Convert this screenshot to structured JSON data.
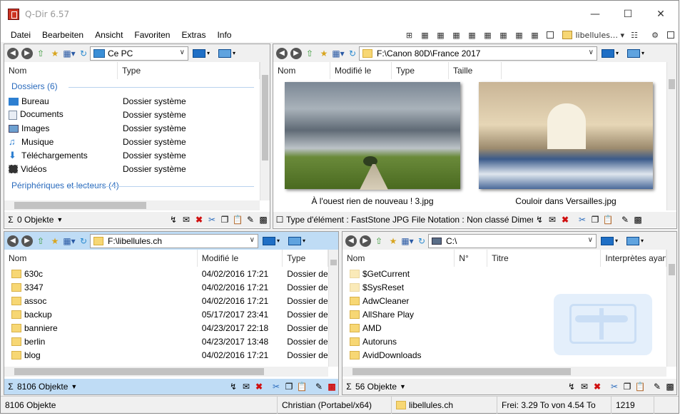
{
  "app": {
    "title": "Q-Dir 6.57"
  },
  "menu": {
    "items": [
      "Datei",
      "Bearbeiten",
      "Ansicht",
      "Favoriten",
      "Extras",
      "Info"
    ],
    "favorites_label": "libellules"
  },
  "panes": {
    "tl": {
      "address": "Ce PC",
      "headers": [
        "Nom",
        "Type"
      ],
      "groups": [
        {
          "label": "Dossiers (6)"
        },
        {
          "label": "Périphériques et lecteurs (4)"
        }
      ],
      "items": [
        {
          "name": "Bureau",
          "type": "Dossier système",
          "icon": "desktop-icon"
        },
        {
          "name": "Documents",
          "type": "Dossier système",
          "icon": "documents-icon"
        },
        {
          "name": "Images",
          "type": "Dossier système",
          "icon": "pictures-icon"
        },
        {
          "name": "Musique",
          "type": "Dossier système",
          "icon": "music-icon"
        },
        {
          "name": "Téléchargements",
          "type": "Dossier système",
          "icon": "downloads-icon"
        },
        {
          "name": "Vidéos",
          "type": "Dossier système",
          "icon": "videos-icon"
        }
      ],
      "status": "0 Objekte"
    },
    "tr": {
      "address": "F:\\Canon 80D\\France 2017",
      "headers": [
        "Nom",
        "Modifié le",
        "Type",
        "Taille"
      ],
      "images": [
        {
          "caption": "À l'ouest rien de nouveau ! 3.jpg"
        },
        {
          "caption": "Couloir dans Versailles.jpg"
        }
      ],
      "status": "Type d'élément : FastStone JPG File Notation : Non classé Dimen"
    },
    "bl": {
      "address": "F:\\libellules.ch",
      "headers": [
        "Nom",
        "Modifié le",
        "Type"
      ],
      "items": [
        {
          "name": "630c",
          "date": "04/02/2016 17:21",
          "type": "Dossier de"
        },
        {
          "name": "3347",
          "date": "04/02/2016 17:21",
          "type": "Dossier de"
        },
        {
          "name": "assoc",
          "date": "04/02/2016 17:21",
          "type": "Dossier de"
        },
        {
          "name": "backup",
          "date": "05/17/2017 23:41",
          "type": "Dossier de"
        },
        {
          "name": "banniere",
          "date": "04/23/2017 22:18",
          "type": "Dossier de"
        },
        {
          "name": "berlin",
          "date": "04/23/2017 13:48",
          "type": "Dossier de"
        },
        {
          "name": "blog",
          "date": "04/02/2016 17:21",
          "type": "Dossier de"
        }
      ],
      "status": "8106 Objekte"
    },
    "br": {
      "address": "C:\\",
      "headers": [
        "Nom",
        "N°",
        "Titre",
        "Interprètes ayan"
      ],
      "items": [
        {
          "name": "$GetCurrent",
          "pale": true
        },
        {
          "name": "$SysReset",
          "pale": true
        },
        {
          "name": "AdwCleaner",
          "pale": false
        },
        {
          "name": "AllShare Play",
          "pale": false
        },
        {
          "name": "AMD",
          "pale": false
        },
        {
          "name": "Autoruns",
          "pale": false
        },
        {
          "name": "AvidDownloads",
          "pale": false
        }
      ],
      "status": "56 Objekte"
    }
  },
  "statusbar": {
    "count": "8106 Objekte",
    "user": "Christian (Portabel/x64)",
    "folder": "libellules.ch",
    "free": "Frei: 3.29 To von 4.54 To",
    "num": "1219"
  },
  "colors": {
    "accent": "#bfdcf5",
    "group": "#2a6bbd",
    "delete": "#d01010"
  }
}
